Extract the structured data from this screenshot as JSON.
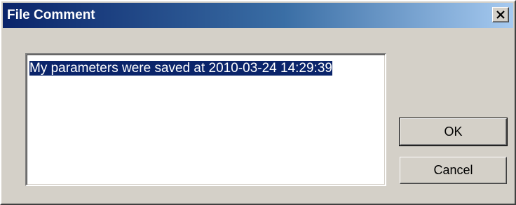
{
  "window": {
    "title": "File Comment",
    "close_icon": "close-icon",
    "titlebar_colors": [
      "#0a246a",
      "#a6caf0"
    ],
    "face_color": "#d4d0c8"
  },
  "comment": {
    "text": "My parameters were saved at 2010-03-24 14:29:39",
    "selected": true,
    "selection_color": "#0a246a"
  },
  "buttons": {
    "ok_label": "OK",
    "cancel_label": "Cancel"
  }
}
